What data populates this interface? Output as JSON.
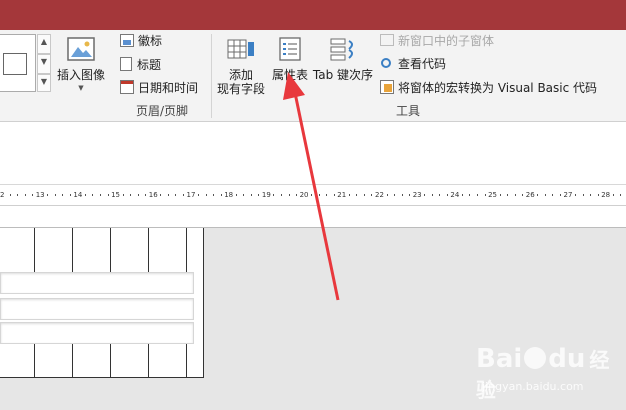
{
  "ribbon": {
    "header_footer_group": {
      "insert_image": "插入图像",
      "logo": "徽标",
      "title": "标题",
      "date_time": "日期和时间",
      "label": "页眉/页脚"
    },
    "tools_group": {
      "add_existing_fields_line1": "添加",
      "add_existing_fields_line2": "现有字段",
      "property_sheet": "属性表",
      "tab_order": "Tab 键次序",
      "subform_in_new_window": "新窗口中的子窗体",
      "view_code": "查看代码",
      "convert_macros": "将窗体的宏转换为 Visual Basic 代码",
      "label": "工具"
    }
  },
  "ruler": {
    "marks": [
      "2",
      "13",
      "14",
      "15",
      "16",
      "17",
      "18",
      "19",
      "20",
      "21",
      "22",
      "23",
      "24",
      "25",
      "26",
      "27",
      "28"
    ]
  },
  "watermark": {
    "brand": "Bai",
    "brand2": "du",
    "suffix": "经验",
    "url": "jingyan.baidu.com"
  },
  "colors": {
    "titlebar": "#a4373a",
    "ribbon": "#f3f3f3",
    "arrow": "#e8383d",
    "workspace": "#e6e6e6"
  }
}
